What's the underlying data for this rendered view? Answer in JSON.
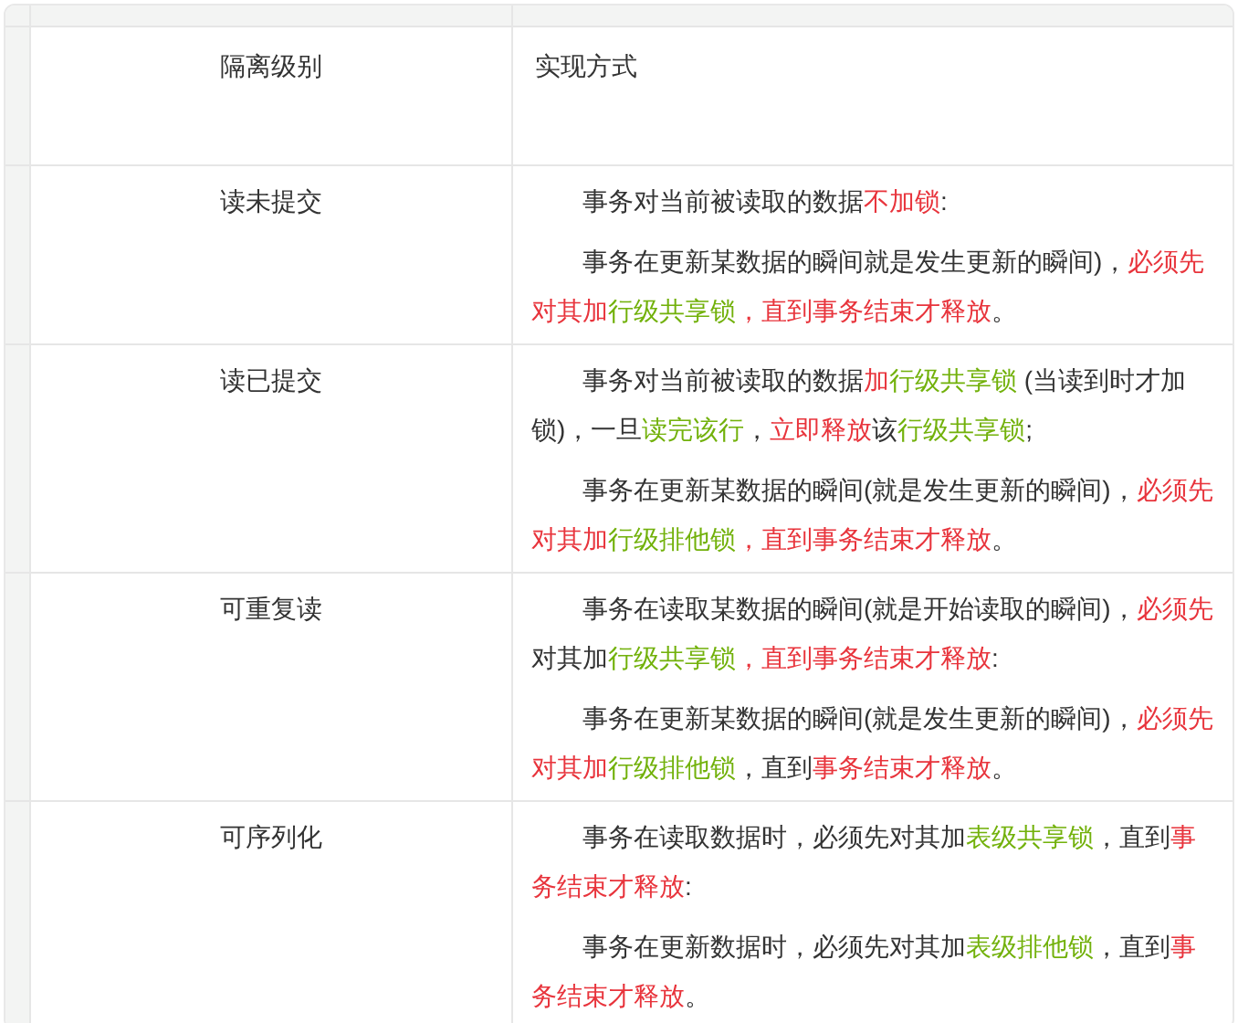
{
  "table": {
    "columns": [
      "隔离级别",
      "实现方式"
    ],
    "rows": [
      {
        "level": "读未提交",
        "paragraphs": [
          [
            {
              "text": "事务对当前被读取的数据",
              "color": "#333333"
            },
            {
              "text": "不加锁",
              "color": "#e8343c"
            },
            {
              "text": ":",
              "color": "#333333"
            }
          ],
          [
            {
              "text": "事务在更新某数据的瞬间就是发生更新的瞬间)，",
              "color": "#333333"
            },
            {
              "text": "必须先对其加",
              "color": "#e8343c"
            },
            {
              "text": "行级共享锁",
              "color": "#72b10b"
            },
            {
              "text": "，直到事务结束才释放",
              "color": "#e8343c"
            },
            {
              "text": "。",
              "color": "#333333"
            }
          ]
        ]
      },
      {
        "level": "读已提交",
        "paragraphs": [
          [
            {
              "text": "事务对当前被读取的数据",
              "color": "#333333"
            },
            {
              "text": "加",
              "color": "#e8343c"
            },
            {
              "text": "行级共享锁",
              "color": "#72b10b"
            },
            {
              "text": " (当读到时才加锁)，一旦",
              "color": "#333333"
            },
            {
              "text": "读完该行",
              "color": "#72b10b"
            },
            {
              "text": "，",
              "color": "#333333"
            },
            {
              "text": "立即释放",
              "color": "#e8343c"
            },
            {
              "text": "该",
              "color": "#333333"
            },
            {
              "text": "行级共享锁",
              "color": "#72b10b"
            },
            {
              "text": ";",
              "color": "#333333"
            }
          ],
          [
            {
              "text": "事务在更新某数据的瞬间(就是发生更新的瞬间)，",
              "color": "#333333"
            },
            {
              "text": "必须先对其加",
              "color": "#e8343c"
            },
            {
              "text": "行级排他锁",
              "color": "#72b10b"
            },
            {
              "text": "，直到事务结束才释放",
              "color": "#e8343c"
            },
            {
              "text": "。",
              "color": "#333333"
            }
          ]
        ]
      },
      {
        "level": "可重复读",
        "paragraphs": [
          [
            {
              "text": "事务在读取某数据的瞬间(就是开始读取的瞬间)，",
              "color": "#333333"
            },
            {
              "text": "必须先",
              "color": "#e8343c"
            },
            {
              "text": "对其加",
              "color": "#333333"
            },
            {
              "text": "行级共享锁",
              "color": "#72b10b"
            },
            {
              "text": "，直到事务结束才释放",
              "color": "#e8343c"
            },
            {
              "text": ":",
              "color": "#333333"
            }
          ],
          [
            {
              "text": "事务在更新某数据的瞬间(就是发生更新的瞬间)，",
              "color": "#333333"
            },
            {
              "text": "必须先对其加",
              "color": "#e8343c"
            },
            {
              "text": "行级排他锁",
              "color": "#72b10b"
            },
            {
              "text": "，直到",
              "color": "#333333"
            },
            {
              "text": "事务结束才释放",
              "color": "#e8343c"
            },
            {
              "text": "。",
              "color": "#333333"
            }
          ]
        ]
      },
      {
        "level": "可序列化",
        "paragraphs": [
          [
            {
              "text": "事务在读取数据时，必须先对其加",
              "color": "#333333"
            },
            {
              "text": "表级共享锁",
              "color": "#72b10b"
            },
            {
              "text": "，直到",
              "color": "#333333"
            },
            {
              "text": "事务结束才释放",
              "color": "#e8343c"
            },
            {
              "text": ":",
              "color": "#333333"
            }
          ],
          [
            {
              "text": "事务在更新数据时，必须先对其加",
              "color": "#333333"
            },
            {
              "text": "表级排他锁",
              "color": "#72b10b"
            },
            {
              "text": "，直到",
              "color": "#333333"
            },
            {
              "text": "事务结束才释放",
              "color": "#e8343c"
            },
            {
              "text": "。",
              "color": "#333333"
            }
          ]
        ]
      }
    ]
  }
}
